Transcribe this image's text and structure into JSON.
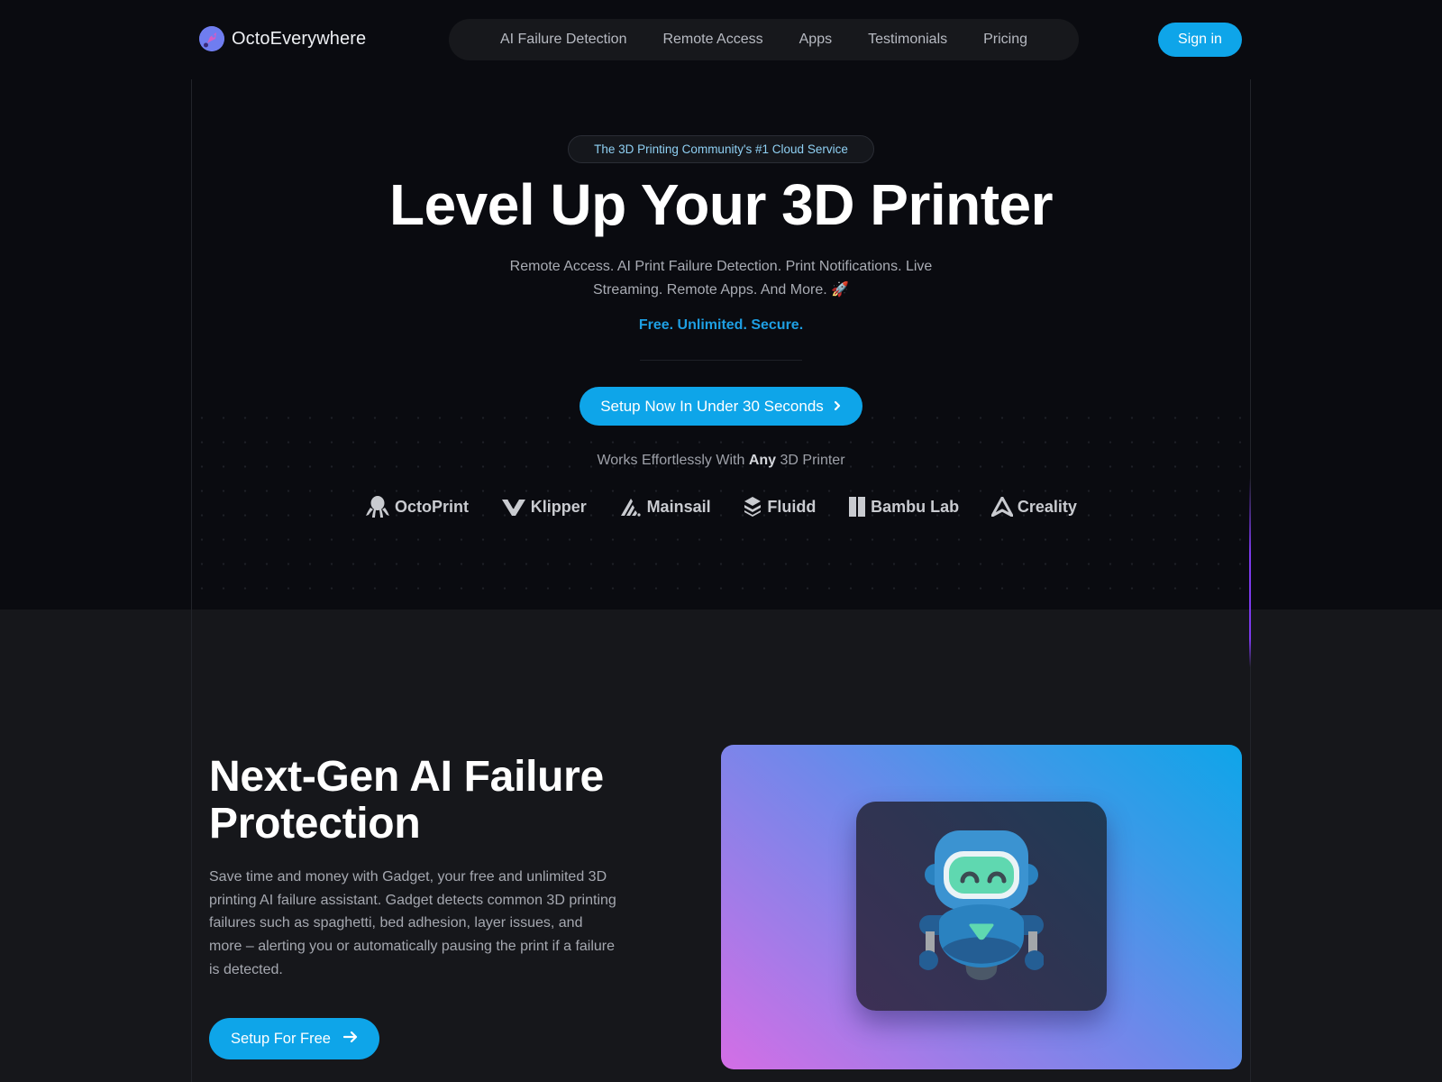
{
  "header": {
    "brand_name": "OctoEverywhere",
    "nav": [
      {
        "label": "AI Failure Detection"
      },
      {
        "label": "Remote Access"
      },
      {
        "label": "Apps"
      },
      {
        "label": "Testimonials"
      },
      {
        "label": "Pricing"
      }
    ],
    "signin_label": "Sign in"
  },
  "hero": {
    "badge": "The 3D Printing Community's #1 Cloud Service",
    "headline": "Level Up Your 3D Printer",
    "subtitle": "Remote Access. AI Print Failure Detection. Print Notifications. Live Streaming. Remote Apps. And More. 🚀",
    "tagline": "Free. Unlimited. Secure.",
    "cta_label": "Setup Now In Under 30 Seconds",
    "cta_icon": "chevron-right-icon",
    "works_prefix": "Works Effortlessly With",
    "works_bold": "Any",
    "works_suffix": "3D Printer",
    "compatible": [
      {
        "name": "OctoPrint",
        "icon": "octopus-icon"
      },
      {
        "name": "Klipper",
        "icon": "klipper-icon"
      },
      {
        "name": "Mainsail",
        "icon": "mainsail-icon"
      },
      {
        "name": "Fluidd",
        "icon": "fluidd-icon"
      },
      {
        "name": "Bambu Lab",
        "icon": "bambu-icon"
      },
      {
        "name": "Creality",
        "icon": "creality-icon"
      }
    ]
  },
  "feature": {
    "title": "Next-Gen AI Failure Protection",
    "body": "Save time and money with Gadget, your free and unlimited 3D printing AI failure assistant. Gadget detects common 3D printing failures such as spaghetti, bed adhesion, layer issues, and more – alerting you or automatically pausing the print if a failure is detected.",
    "cta_label": "Setup For Free",
    "cta_icon": "arrow-right-icon",
    "illustration": "robot-gadget"
  },
  "colors": {
    "accent": "#0ea5e9",
    "tagline": "#1e9fe3",
    "badge_text": "#8fd0f3",
    "hero_bg": "#0a0b10",
    "section_bg": "#16171b"
  }
}
